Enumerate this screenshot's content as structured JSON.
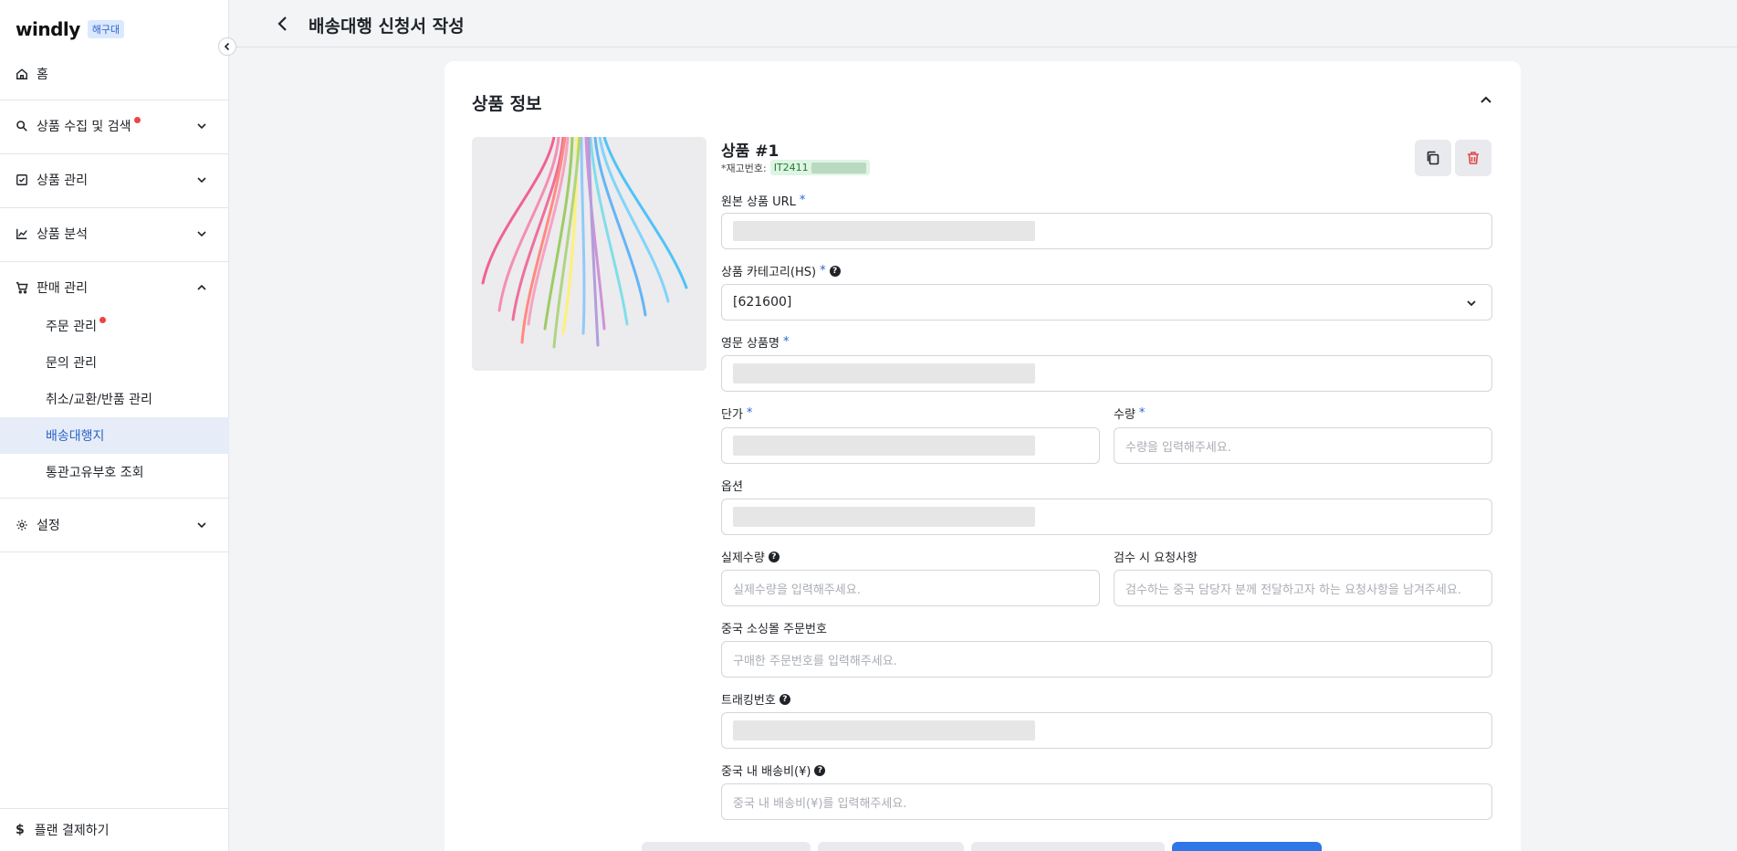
{
  "brand": {
    "logo": "windly",
    "badge": "해구대"
  },
  "sidebar": {
    "home": "홈",
    "items": [
      {
        "label": "상품 수집 및 검색",
        "icon": "search-icon",
        "dot": true,
        "expanded": false
      },
      {
        "label": "상품 관리",
        "icon": "checkbox-icon",
        "dot": false,
        "expanded": false
      },
      {
        "label": "상품 분석",
        "icon": "chart-icon",
        "dot": false,
        "expanded": false
      },
      {
        "label": "판매 관리",
        "icon": "cart-icon",
        "dot": false,
        "expanded": true
      },
      {
        "label": "설정",
        "icon": "gear-icon",
        "dot": false,
        "expanded": false
      }
    ],
    "sub_items": [
      {
        "label": "주문 관리",
        "dot": true,
        "active": false
      },
      {
        "label": "문의 관리",
        "dot": false,
        "active": false
      },
      {
        "label": "취소/교환/반품 관리",
        "dot": false,
        "active": false
      },
      {
        "label": "배송대행지",
        "dot": false,
        "active": true
      },
      {
        "label": "통관고유부호 조회",
        "dot": false,
        "active": false
      }
    ],
    "plan": "플랜 결제하기"
  },
  "header": {
    "title": "배송대행 신청서 작성"
  },
  "card": {
    "title": "상품 정보",
    "product_title": "상품 #1",
    "stock_label": "*재고번호:",
    "stock_code": "IT2411",
    "fields": {
      "url_label": "원본 상품 URL",
      "category_label": "상품 카테고리(HS)",
      "category_value": "[621600]",
      "eng_name_label": "영문 상품명",
      "price_label": "단가",
      "qty_label": "수량",
      "qty_placeholder": "수량을 입력해주세요.",
      "option_label": "옵션",
      "actual_qty_label": "실제수량",
      "actual_qty_placeholder": "실제수량을 입력해주세요.",
      "inspect_label": "검수 시 요청사항",
      "inspect_placeholder": "검수하는 중국 담당자 분께 전달하고자 하는 요청사항을 남겨주세요.",
      "order_no_label": "중국 소싱몰 주문번호",
      "order_no_placeholder": "구매한 주문번호를 입력해주세요.",
      "tracking_label": "트래킹번호",
      "shipping_label": "중국 내 배송비(¥)",
      "shipping_placeholder": "중국 내 배송비(¥)를 입력해주세요."
    },
    "required_mark": "*",
    "help_mark": "?"
  },
  "colors": {
    "accent": "#2d63c8",
    "primary_button": "#2f76e9",
    "dot": "#ef4444",
    "stock_bg": "#def5e3"
  }
}
